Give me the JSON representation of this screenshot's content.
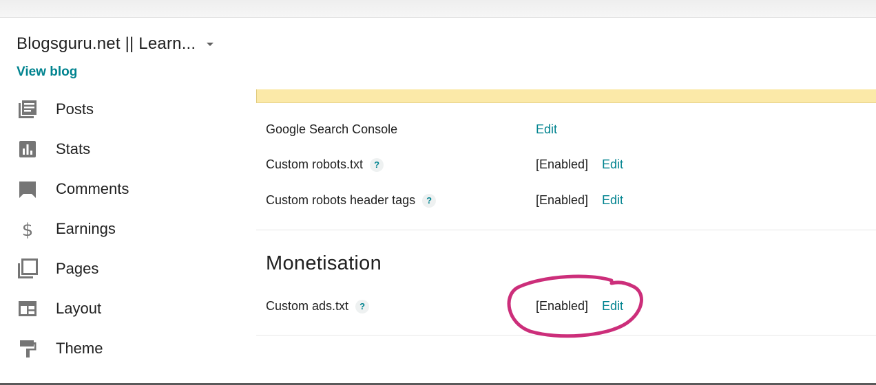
{
  "header": {
    "blog_title": "Blogsguru.net || Learn...",
    "view_blog": "View blog"
  },
  "sidebar": {
    "items": [
      {
        "label": "Posts",
        "icon": "posts-icon"
      },
      {
        "label": "Stats",
        "icon": "stats-icon"
      },
      {
        "label": "Comments",
        "icon": "comments-icon"
      },
      {
        "label": "Earnings",
        "icon": "dollar-icon"
      },
      {
        "label": "Pages",
        "icon": "pages-icon"
      },
      {
        "label": "Layout",
        "icon": "layout-icon"
      },
      {
        "label": "Theme",
        "icon": "theme-icon"
      }
    ]
  },
  "crawlers": {
    "rows": [
      {
        "label": "Google Search Console",
        "status": "",
        "edit": "Edit",
        "help": false
      },
      {
        "label": "Custom robots.txt",
        "status": "[Enabled]",
        "edit": "Edit",
        "help": "?"
      },
      {
        "label": "Custom robots header tags",
        "status": "[Enabled]",
        "edit": "Edit",
        "help": "?"
      }
    ]
  },
  "monetisation": {
    "title": "Monetisation",
    "rows": [
      {
        "label": "Custom ads.txt",
        "status": "[Enabled]",
        "edit": "Edit",
        "help": "?"
      }
    ]
  },
  "colors": {
    "accent": "#00838f",
    "notice_bg": "#fbe9a8",
    "annotation": "#cc2e7a"
  }
}
